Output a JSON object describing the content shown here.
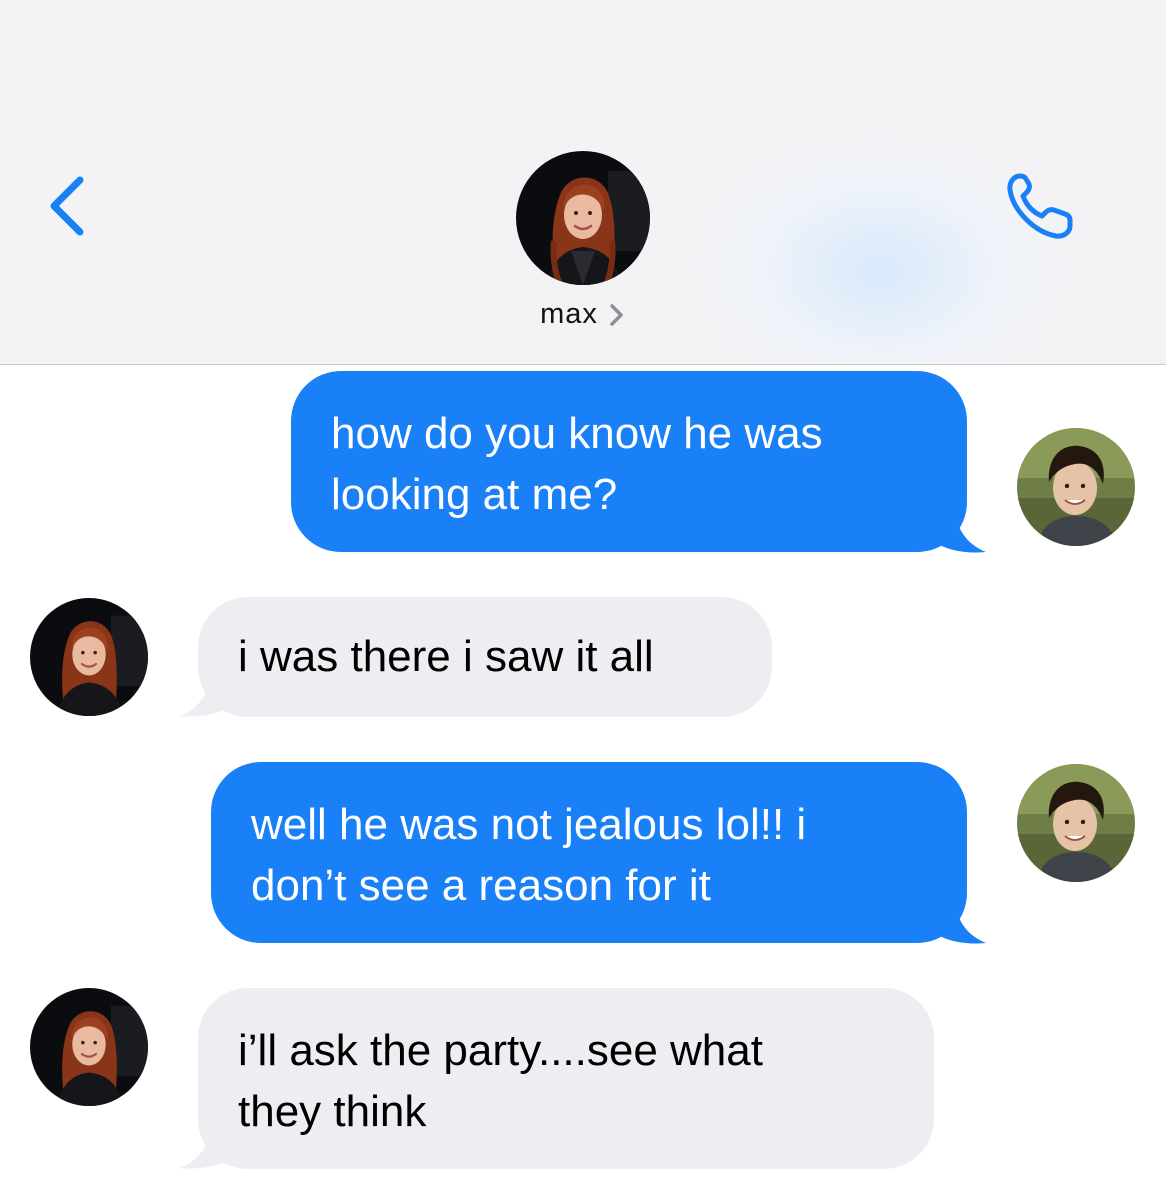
{
  "header": {
    "contact_name": "max",
    "back_icon": "chevron-left-icon",
    "call_icon": "phone-icon",
    "name_chevron_icon": "chevron-right-icon",
    "accent_color": "#1a80f7"
  },
  "messages": [
    {
      "direction": "sent",
      "text": "how do you know he was\nlooking at me?"
    },
    {
      "direction": "received",
      "text": "i was there i saw it all"
    },
    {
      "direction": "sent",
      "text": "well he was not jealous lol!! i\ndon’t see a reason for it"
    },
    {
      "direction": "received",
      "text": "i’ll ask the party....see what\nthey think"
    }
  ],
  "colors": {
    "sent_bubble": "#1a80f7",
    "received_bubble": "#eeeef2",
    "header_background": "#f3f3f5"
  }
}
